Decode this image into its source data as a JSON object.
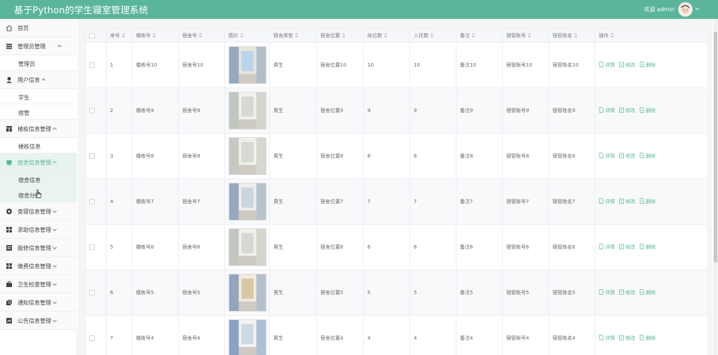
{
  "app": {
    "title": "基于Python的学生寝室管理系统",
    "welcome": "欢迎 admin",
    "accent_color": "#5ab59b"
  },
  "sidebar": {
    "items": [
      {
        "label": "首页",
        "icon": "home-icon"
      },
      {
        "label": "管理员管理",
        "icon": "admin-icon",
        "expanded": true
      },
      {
        "label": "管理员",
        "sub": true
      },
      {
        "label": "用户信息",
        "icon": "user-icon",
        "expanded": true
      },
      {
        "label": "学生",
        "sub": true
      },
      {
        "label": "宿管",
        "sub": true
      },
      {
        "label": "楼栋信息管理",
        "icon": "building-icon",
        "expanded": true
      },
      {
        "label": "楼栋信息",
        "sub": true
      },
      {
        "label": "宿舍信息管理",
        "icon": "dorm-icon",
        "expanded": true,
        "active": true
      },
      {
        "label": "宿舍信息",
        "sub": true
      },
      {
        "label": "宿舍分配",
        "sub": true
      },
      {
        "label": "查寝信息管理",
        "icon": "check-icon"
      },
      {
        "label": "求助信息管理",
        "icon": "help-icon"
      },
      {
        "label": "报修信息管理",
        "icon": "repair-icon"
      },
      {
        "label": "缴费信息管理",
        "icon": "payment-icon"
      },
      {
        "label": "卫生检查管理",
        "icon": "hygiene-icon"
      },
      {
        "label": "通知信息管理",
        "icon": "notice-icon"
      },
      {
        "label": "公告信息管理",
        "icon": "announcement-icon"
      }
    ]
  },
  "table": {
    "headers": [
      "序号",
      "楼栋号",
      "宿舍号",
      "图片",
      "宿舍类型",
      "宿舍位置",
      "床位数",
      "入住数",
      "备注",
      "宿管账号",
      "宿管姓名",
      "操作"
    ],
    "actions": {
      "detail": "详情",
      "edit": "修改",
      "delete": "删除"
    },
    "rows": [
      {
        "index": "1",
        "building": "楼栋号10",
        "room": "宿舍号10",
        "type": "男生",
        "location": "宿舍位置10",
        "beds": "10",
        "occupied": "10",
        "note": "备注10",
        "manager_account": "宿管账号10",
        "manager_name": "宿管姓名10"
      },
      {
        "index": "2",
        "building": "楼栋号9",
        "room": "宿舍号9",
        "type": "男生",
        "location": "宿舍位置9",
        "beds": "9",
        "occupied": "9",
        "note": "备注9",
        "manager_account": "宿管账号9",
        "manager_name": "宿管姓名9"
      },
      {
        "index": "3",
        "building": "楼栋号8",
        "room": "宿舍号8",
        "type": "男生",
        "location": "宿舍位置8",
        "beds": "8",
        "occupied": "8",
        "note": "备注8",
        "manager_account": "宿管账号8",
        "manager_name": "宿管姓名8"
      },
      {
        "index": "4",
        "building": "楼栋号7",
        "room": "宿舍号7",
        "type": "男生",
        "location": "宿舍位置7",
        "beds": "7",
        "occupied": "7",
        "note": "备注7",
        "manager_account": "宿管账号7",
        "manager_name": "宿管姓名7"
      },
      {
        "index": "5",
        "building": "楼栋号6",
        "room": "宿舍号6",
        "type": "男生",
        "location": "宿舍位置6",
        "beds": "6",
        "occupied": "6",
        "note": "备注6",
        "manager_account": "宿管账号6",
        "manager_name": "宿管姓名6"
      },
      {
        "index": "6",
        "building": "楼栋号5",
        "room": "宿舍号5",
        "type": "男生",
        "location": "宿舍位置5",
        "beds": "5",
        "occupied": "5",
        "note": "备注5",
        "manager_account": "宿管账号5",
        "manager_name": "宿管姓名5"
      },
      {
        "index": "7",
        "building": "楼栋号4",
        "room": "宿舍号4",
        "type": "男生",
        "location": "宿舍位置4",
        "beds": "4",
        "occupied": "4",
        "note": "备注4",
        "manager_account": "宿管账号4",
        "manager_name": "宿管姓名4"
      }
    ]
  }
}
